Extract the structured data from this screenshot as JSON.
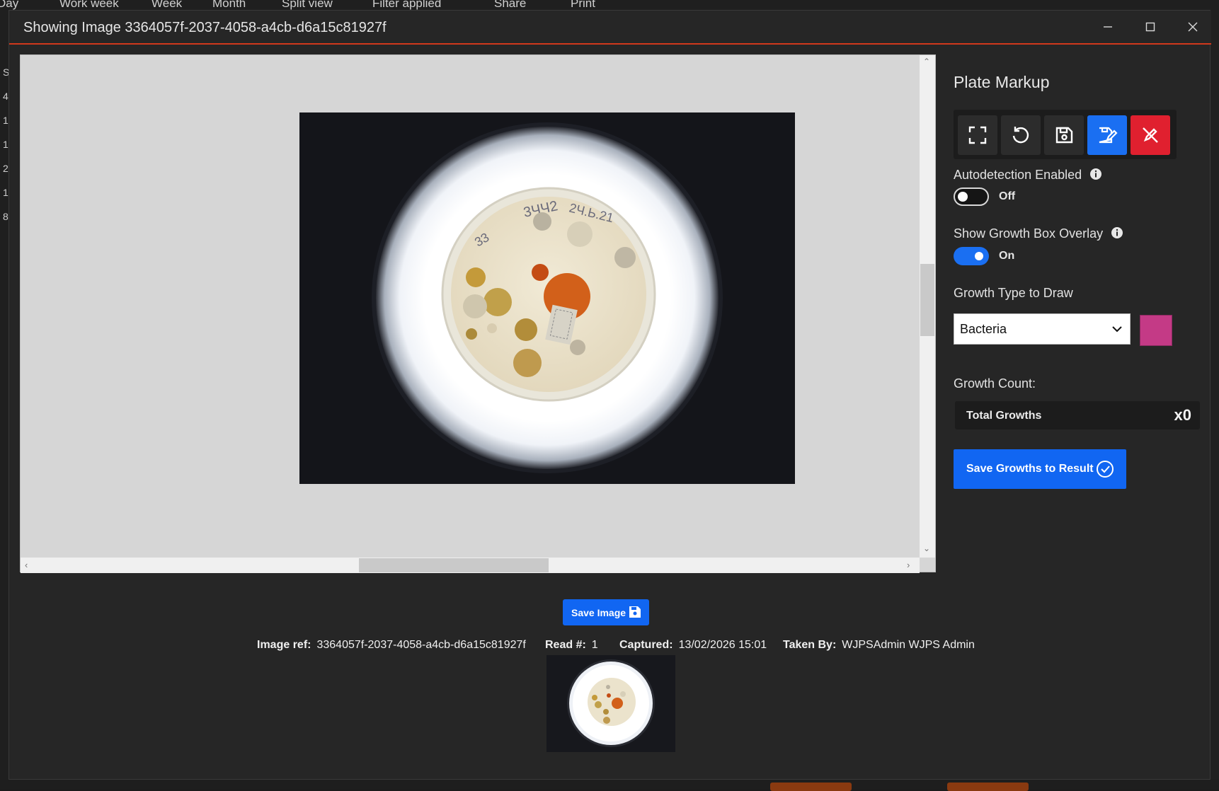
{
  "background_app": {
    "toolbar_items": [
      "Day",
      "Work week",
      "Week",
      "Month",
      "Split view",
      "Filter applied",
      "Share",
      "Print"
    ],
    "left_edge_chars": [
      "S",
      "4",
      "1",
      "1:",
      "2:",
      "1",
      "8"
    ]
  },
  "window": {
    "title": "Showing Image 3364057f-2037-4058-a4cb-d6a15c81927f",
    "controls": [
      "minimize-icon",
      "maximize-icon",
      "close-icon"
    ]
  },
  "panel": {
    "title": "Plate Markup",
    "tools": [
      {
        "icon": "fullscreen-icon"
      },
      {
        "icon": "undo-icon"
      },
      {
        "icon": "save-icon"
      },
      {
        "icon": "edit-save-icon",
        "color": "#1a6ff2"
      },
      {
        "icon": "clear-markup-icon",
        "color": "#e0202f"
      }
    ],
    "autodetection": {
      "label": "Autodetection Enabled",
      "state": "Off",
      "on": false
    },
    "overlay": {
      "label": "Show Growth Box Overlay",
      "state": "On",
      "on": true
    },
    "growth_type": {
      "label": "Growth Type to Draw",
      "selected": "Bacteria",
      "color": "#c43a86"
    },
    "growth_count": {
      "label": "Growth Count:",
      "total_label": "Total Growths",
      "total_value": "x0"
    },
    "save_growths_label": "Save Growths to Result"
  },
  "footer": {
    "save_image_label": "Save Image",
    "image_ref_label": "Image ref:",
    "image_ref_value": "3364057f-2037-4058-a4cb-d6a15c81927f",
    "read_label": "Read #:",
    "read_value": "1",
    "captured_label": "Captured:",
    "captured_value": "13/02/2026 15:01",
    "taken_by_label": "Taken By:",
    "taken_by_value": "WJPSAdmin WJPS Admin"
  },
  "colors": {
    "accent_blue": "#1166f2",
    "danger_red": "#e0202f",
    "title_underline": "#d0381c"
  }
}
